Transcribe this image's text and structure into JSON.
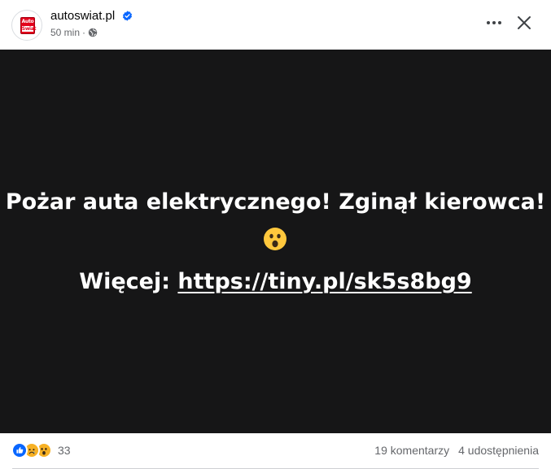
{
  "post": {
    "page_name": "autoswiat.pl",
    "logo_text": [
      "Auto",
      "Świat"
    ],
    "time": "50 min",
    "separator": "·",
    "verified_icon": "verified-badge-icon",
    "audience_icon": "globe-icon",
    "more_icon": "more-horizontal-icon",
    "close_icon": "close-icon"
  },
  "media": {
    "headline": "Pożar auta elektrycznego! Zginął kierowca!",
    "emoji": "😮",
    "more_label": "Więcej:",
    "link": "https://tiny.pl/sk5s8bg9",
    "background": "#161617"
  },
  "footer": {
    "reactions": [
      "like",
      "sad",
      "wow"
    ],
    "reaction_count": "33",
    "comments": "19 komentarzy",
    "shares": "4 udostępnienia"
  },
  "colors": {
    "accent": "#0866ff",
    "secondary_text": "#65676b",
    "primary_text": "#050505"
  }
}
